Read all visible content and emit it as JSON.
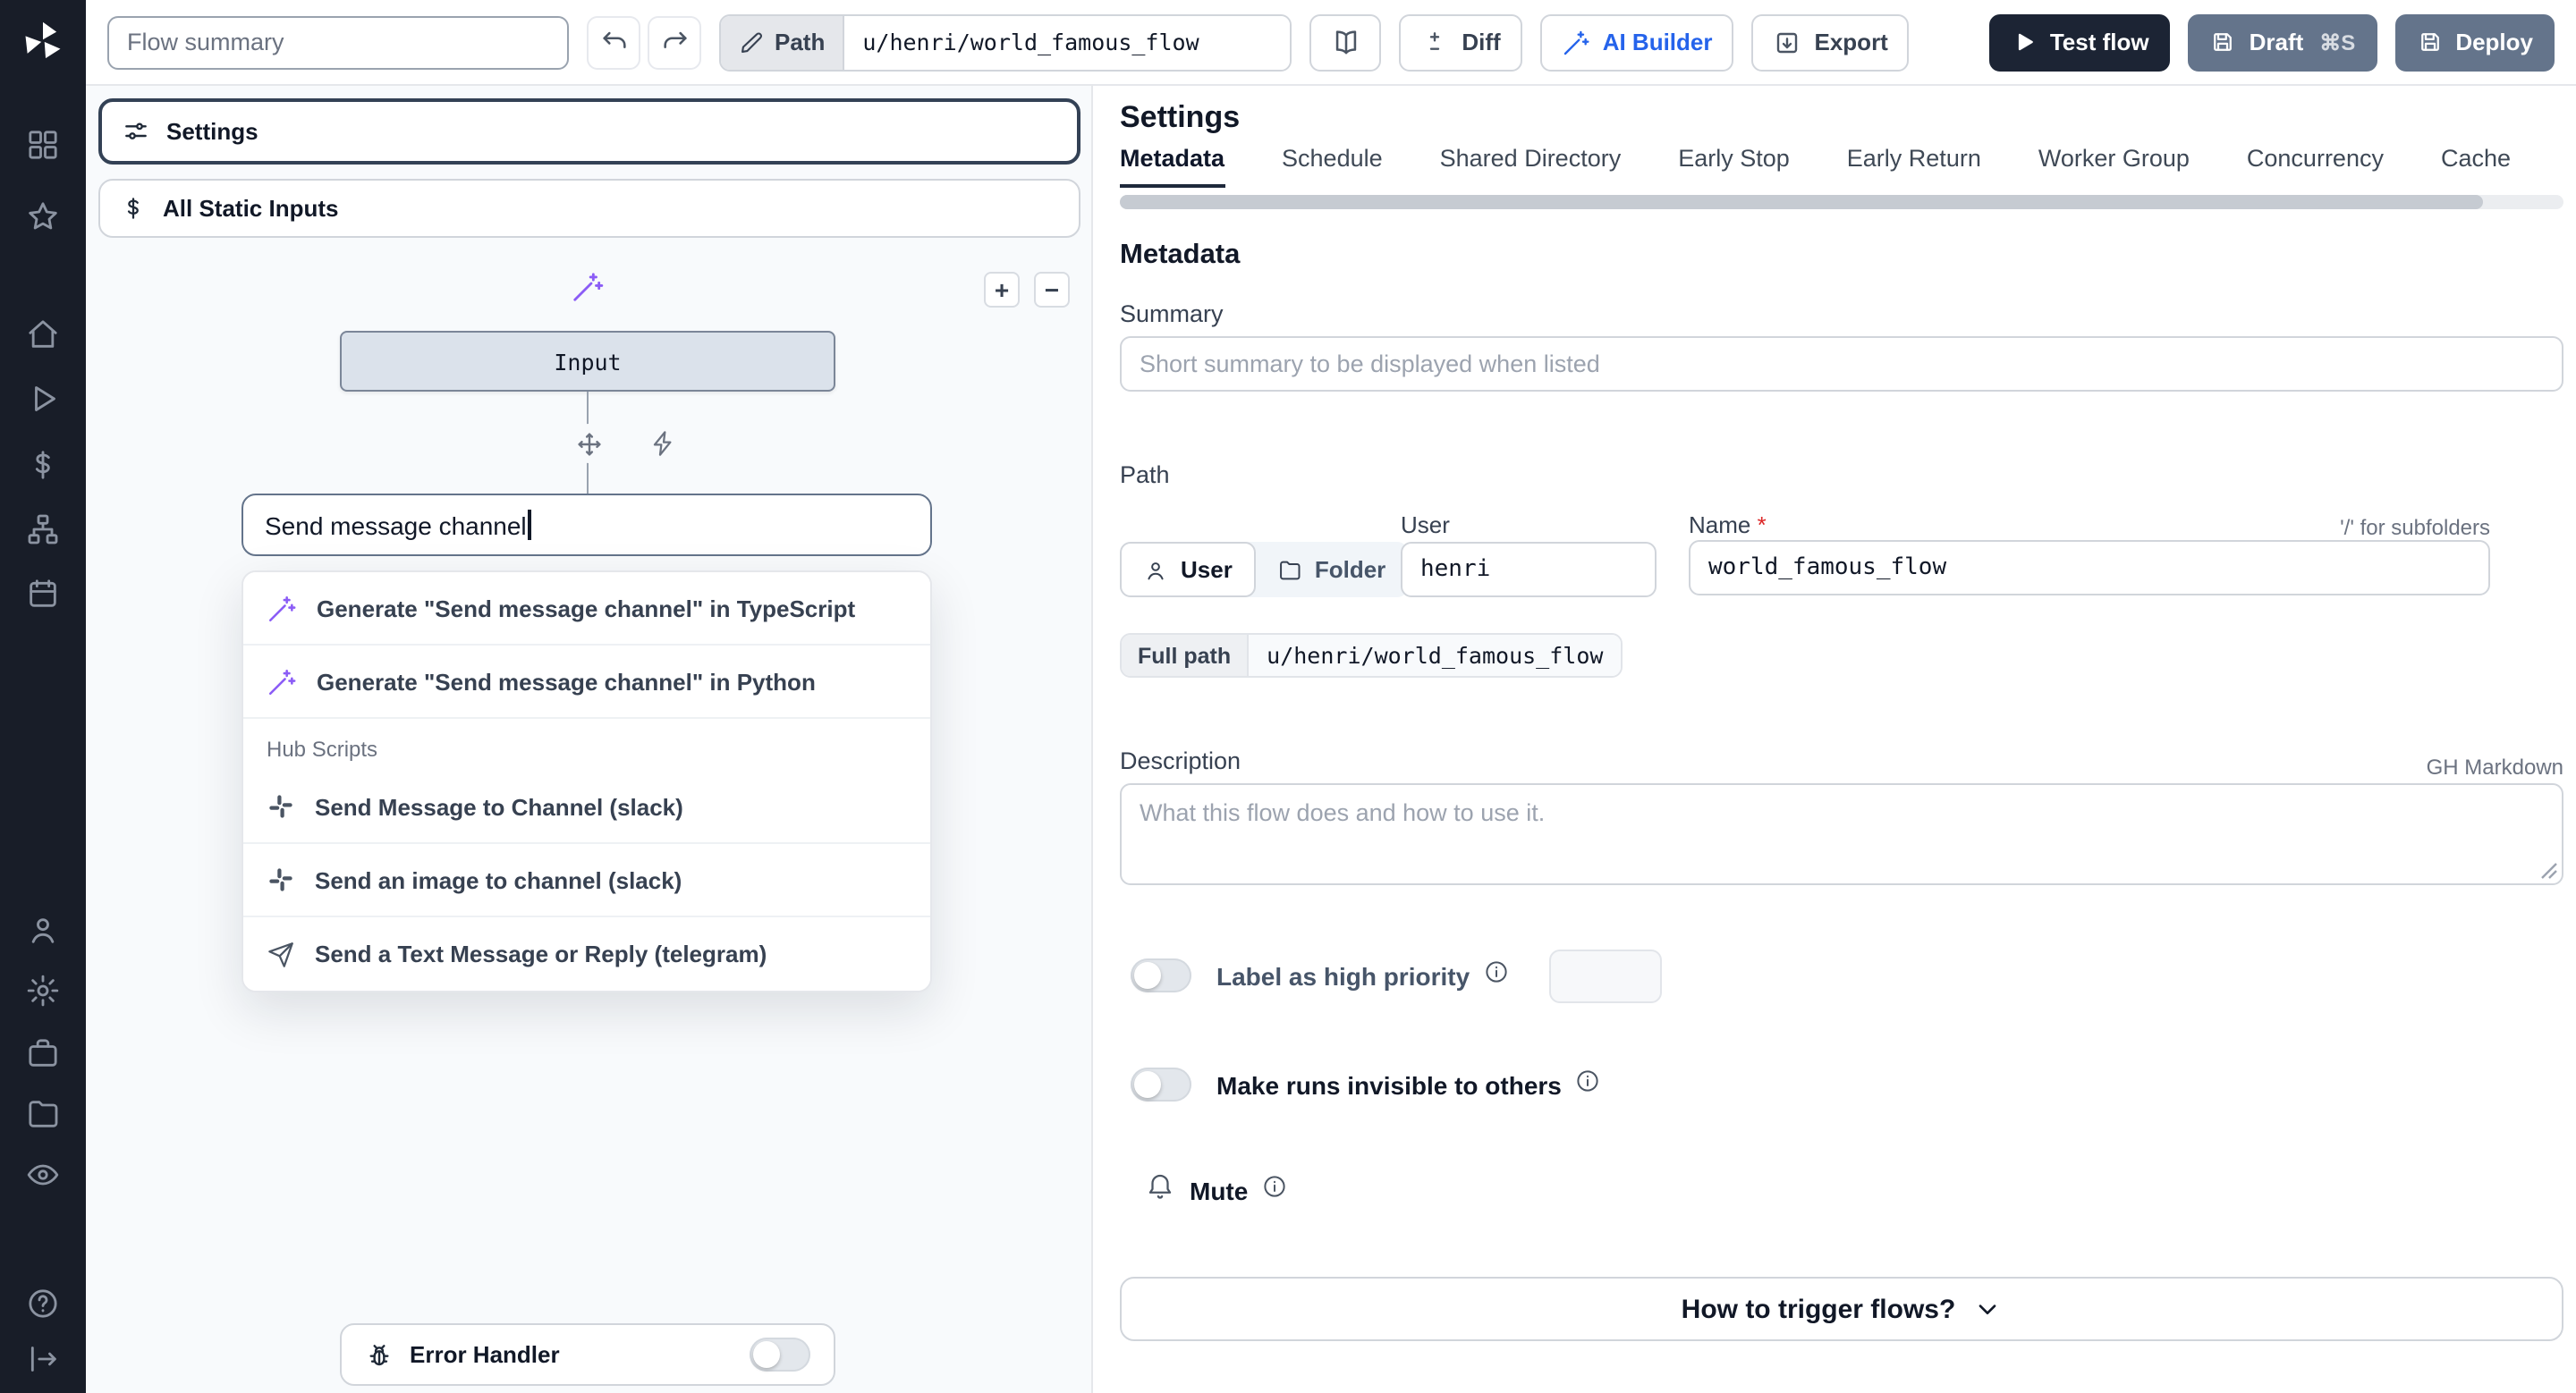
{
  "topbar": {
    "flow_summary_placeholder": "Flow summary",
    "path_tag": "Path",
    "path_value": "u/henri/world_famous_flow",
    "diff": "Diff",
    "ai_builder": "AI Builder",
    "export": "Export",
    "test_flow": "Test flow",
    "draft": "Draft",
    "draft_shortcut": "⌘S",
    "deploy": "Deploy"
  },
  "flow_editor": {
    "settings": "Settings",
    "all_static_inputs": "All Static Inputs",
    "input_node": "Input",
    "zoom_in": "+",
    "zoom_out": "−",
    "search_value": "Send message channel",
    "generate_items": [
      {
        "icon": "wand-icon",
        "label": "Generate \"Send message channel\" in TypeScript"
      },
      {
        "icon": "wand-icon",
        "label": "Generate \"Send message channel\" in Python"
      }
    ],
    "hub_header": "Hub Scripts",
    "hub_items": [
      {
        "icon": "slack-icon",
        "label": "Send Message to Channel (slack)"
      },
      {
        "icon": "slack-icon",
        "label": "Send an image to channel (slack)"
      },
      {
        "icon": "telegram-icon",
        "label": "Send a Text Message or Reply (telegram)"
      }
    ],
    "error_handler": "Error Handler"
  },
  "settings_panel": {
    "title": "Settings",
    "tabs": [
      "Metadata",
      "Schedule",
      "Shared Directory",
      "Early Stop",
      "Early Return",
      "Worker Group",
      "Concurrency",
      "Cache"
    ],
    "active_tab": "Metadata",
    "metadata_heading": "Metadata",
    "summary_label": "Summary",
    "summary_placeholder": "Short summary to be displayed when listed",
    "path_label": "Path",
    "owner_kind_user": "User",
    "owner_kind_folder": "Folder",
    "user_field_label": "User",
    "user_value": "henri",
    "name_label": "Name",
    "required_marker": "*",
    "subfolder_hint": "'/' for subfolders",
    "name_value": "world_famous_flow",
    "full_path_label": "Full path",
    "full_path_value": "u/henri/world_famous_flow",
    "description_label": "Description",
    "markdown_hint": "GH Markdown",
    "description_placeholder": "What this flow does and how to use it.",
    "high_priority_label": "Label as high priority",
    "invisible_runs_label": "Make runs invisible to others",
    "mute_label": "Mute",
    "trigger_question": "How to trigger flows?"
  },
  "colors": {
    "accent_blue": "#2563eb",
    "violet": "#8b5cf6",
    "dark_button": "#1c2434",
    "slate_button": "#64748b",
    "selected_border": "#334155"
  }
}
